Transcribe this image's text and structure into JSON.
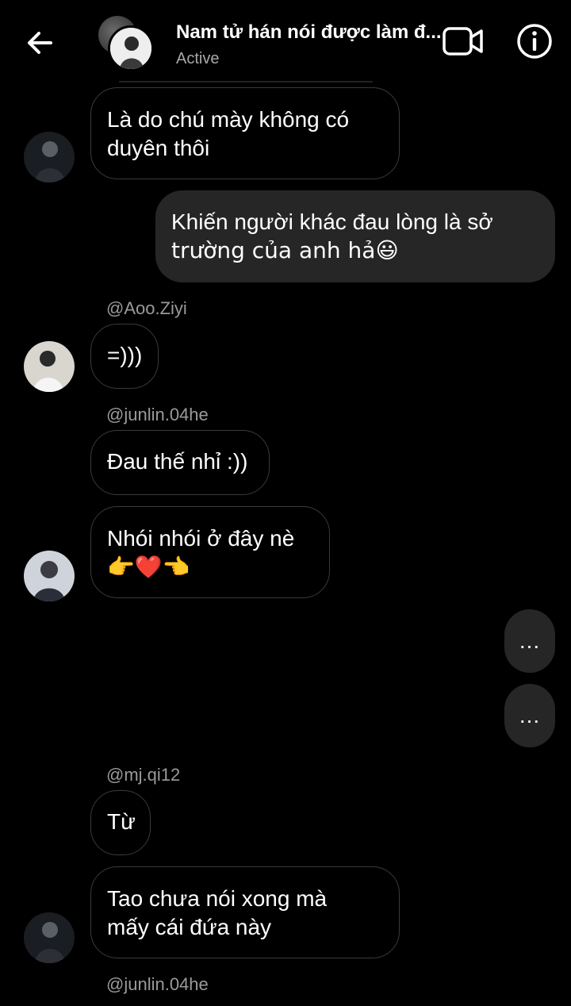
{
  "header": {
    "title": "Nam tử hán nói được làm đ...",
    "status": "Active",
    "back_icon": "arrow-left-icon",
    "video_icon": "video-camera-icon",
    "info_icon": "info-icon"
  },
  "messages": [
    {
      "text_lines": [
        "Là do chú mày không có",
        "duyên thôi"
      ]
    },
    {
      "text_lines": [
        "Khiến người khác đau lòng là sở",
        "trường của anh hả😃"
      ]
    },
    {
      "mention": "@Aoo.Ziyi",
      "text": "=)))"
    },
    {
      "mention": "@junlin.04he",
      "text": "Đau thế nhỉ :))"
    },
    {
      "text_lines": [
        "Nhói nhói ở đây nè",
        "👉❤️👈"
      ]
    },
    {
      "text": "..."
    },
    {
      "text": "..."
    },
    {
      "mention": "@mj.qi12",
      "text": "Từ"
    },
    {
      "text_lines": [
        "Tao chưa nói xong mà",
        "mấy cái đứa này"
      ]
    },
    {
      "mention": "@junlin.04he"
    }
  ],
  "colors": {
    "background": "#000000",
    "own_bubble": "#262626",
    "border": "#3a3a3a",
    "muted_text": "#a8a8a8"
  }
}
